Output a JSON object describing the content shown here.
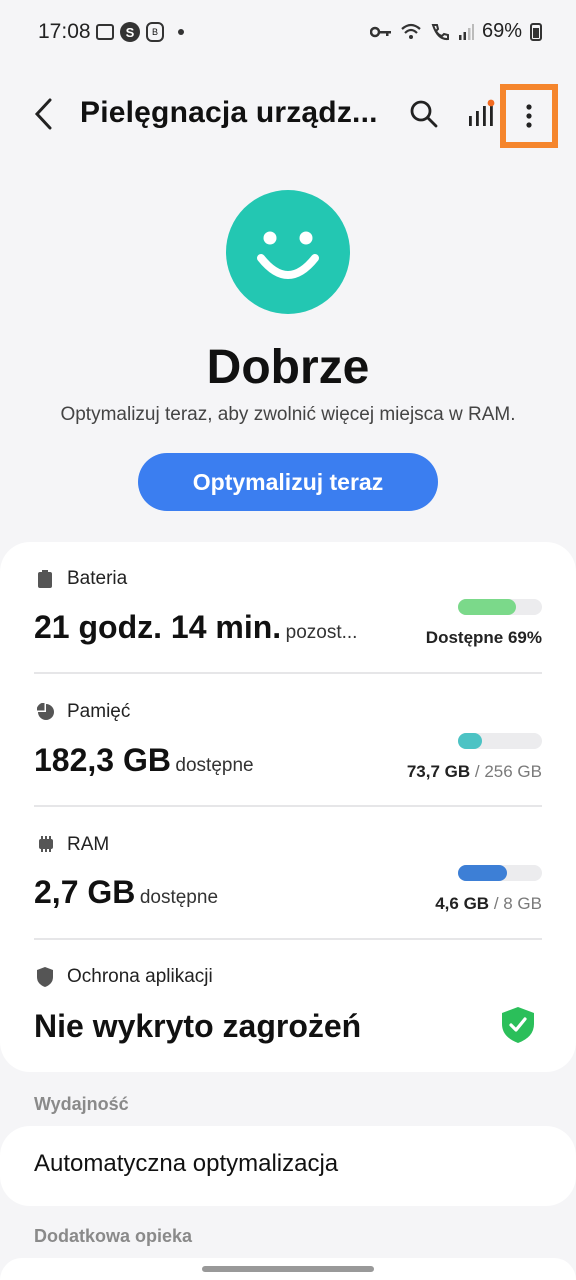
{
  "status_bar": {
    "time": "17:08",
    "battery_percent": "69%",
    "icons": [
      "gallery-icon",
      "s-app-icon",
      "secure-folder-icon",
      "notification-dot-icon",
      "vpn-key-icon",
      "wifi-icon",
      "wifi-calling-icon",
      "cellular-signal-icon",
      "battery-icon"
    ]
  },
  "header": {
    "title": "Pielęgnacja urządz...",
    "icons": [
      "back-icon",
      "search-icon",
      "signal-report-icon",
      "more-options-icon"
    ],
    "accent_highlight": "#f5852c"
  },
  "hero": {
    "status": "Dobrze",
    "description": "Optymalizuj teraz, aby zwolnić więcej miejsca w RAM.",
    "button_label": "Optymalizuj teraz",
    "smiley_color": "#23c7b2",
    "button_color": "#3b7ef0"
  },
  "battery": {
    "label": "Bateria",
    "value": "21 godz. 14 min.",
    "suffix": "pozost...",
    "right_text": "Dostępne 69%",
    "fill_fraction": 0.69,
    "bar_color": "#7bd98a"
  },
  "storage": {
    "label": "Pamięć",
    "value": "182,3 GB",
    "suffix": "dostępne",
    "used": "73,7 GB",
    "total": "/ 256 GB",
    "fill_fraction": 0.29,
    "bar_color": "#4cc3c4"
  },
  "ram": {
    "label": "RAM",
    "value": "2,7 GB",
    "suffix": "dostępne",
    "used": "4,6 GB",
    "total": "/ 8 GB",
    "fill_fraction": 0.58,
    "bar_color": "#3d7fd6"
  },
  "app_protection": {
    "label": "Ochrona aplikacji",
    "value": "Nie wykryto zagrożeń",
    "shield_color": "#2bbf5a"
  },
  "sections": {
    "performance_title": "Wydajność",
    "auto_optimization": "Automatyczna optymalizacja",
    "extra_care_title": "Dodatkowa opieka"
  }
}
